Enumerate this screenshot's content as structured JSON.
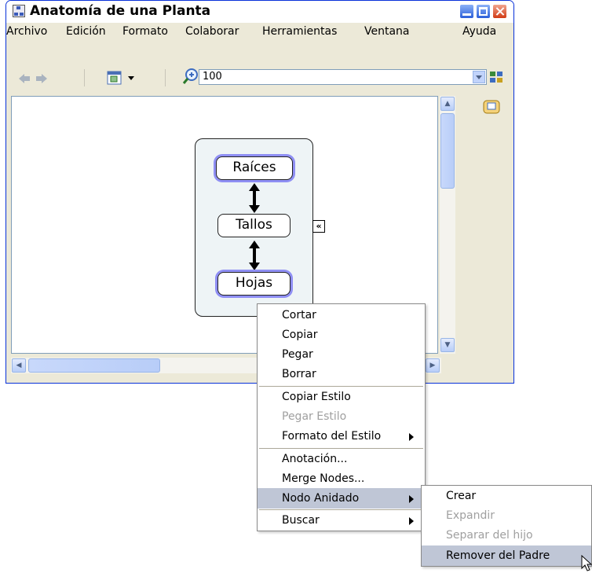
{
  "window": {
    "title": "Anatomía de una Planta"
  },
  "menubar": [
    "Archivo",
    "Edición",
    "Formato",
    "Colaborar",
    "Herramientas",
    "Ventana",
    "Ayuda"
  ],
  "toolbar": {
    "zoom_value": "100"
  },
  "canvas": {
    "nodes": [
      "Raíces",
      "Tallos",
      "Hojas"
    ],
    "collapse_glyph": "«"
  },
  "context_menu": [
    {
      "label": "Cortar",
      "enabled": true
    },
    {
      "label": "Copiar",
      "enabled": true
    },
    {
      "label": "Pegar",
      "enabled": true
    },
    {
      "label": "Borrar",
      "enabled": true
    },
    {
      "label": "Copiar Estilo",
      "enabled": true
    },
    {
      "label": "Pegar Estilo",
      "enabled": false
    },
    {
      "label": "Formato del Estilo",
      "enabled": true,
      "submenu": true
    },
    {
      "label": "Anotación...",
      "enabled": true
    },
    {
      "label": "Merge Nodes...",
      "enabled": true
    },
    {
      "label": "Nodo Anidado",
      "enabled": true,
      "submenu": true,
      "highlighted": true
    },
    {
      "label": "Buscar",
      "enabled": true,
      "submenu": true
    }
  ],
  "submenu": [
    {
      "label": "Crear",
      "enabled": true
    },
    {
      "label": "Expandir",
      "enabled": false
    },
    {
      "label": "Separar del hijo",
      "enabled": false
    },
    {
      "label": "Remover del Padre",
      "enabled": true,
      "highlighted": true
    }
  ],
  "colors": {
    "highlight": "#bfc6d6",
    "node_selection": "#8f8ff4",
    "title_bar_border": "#0831d9"
  }
}
